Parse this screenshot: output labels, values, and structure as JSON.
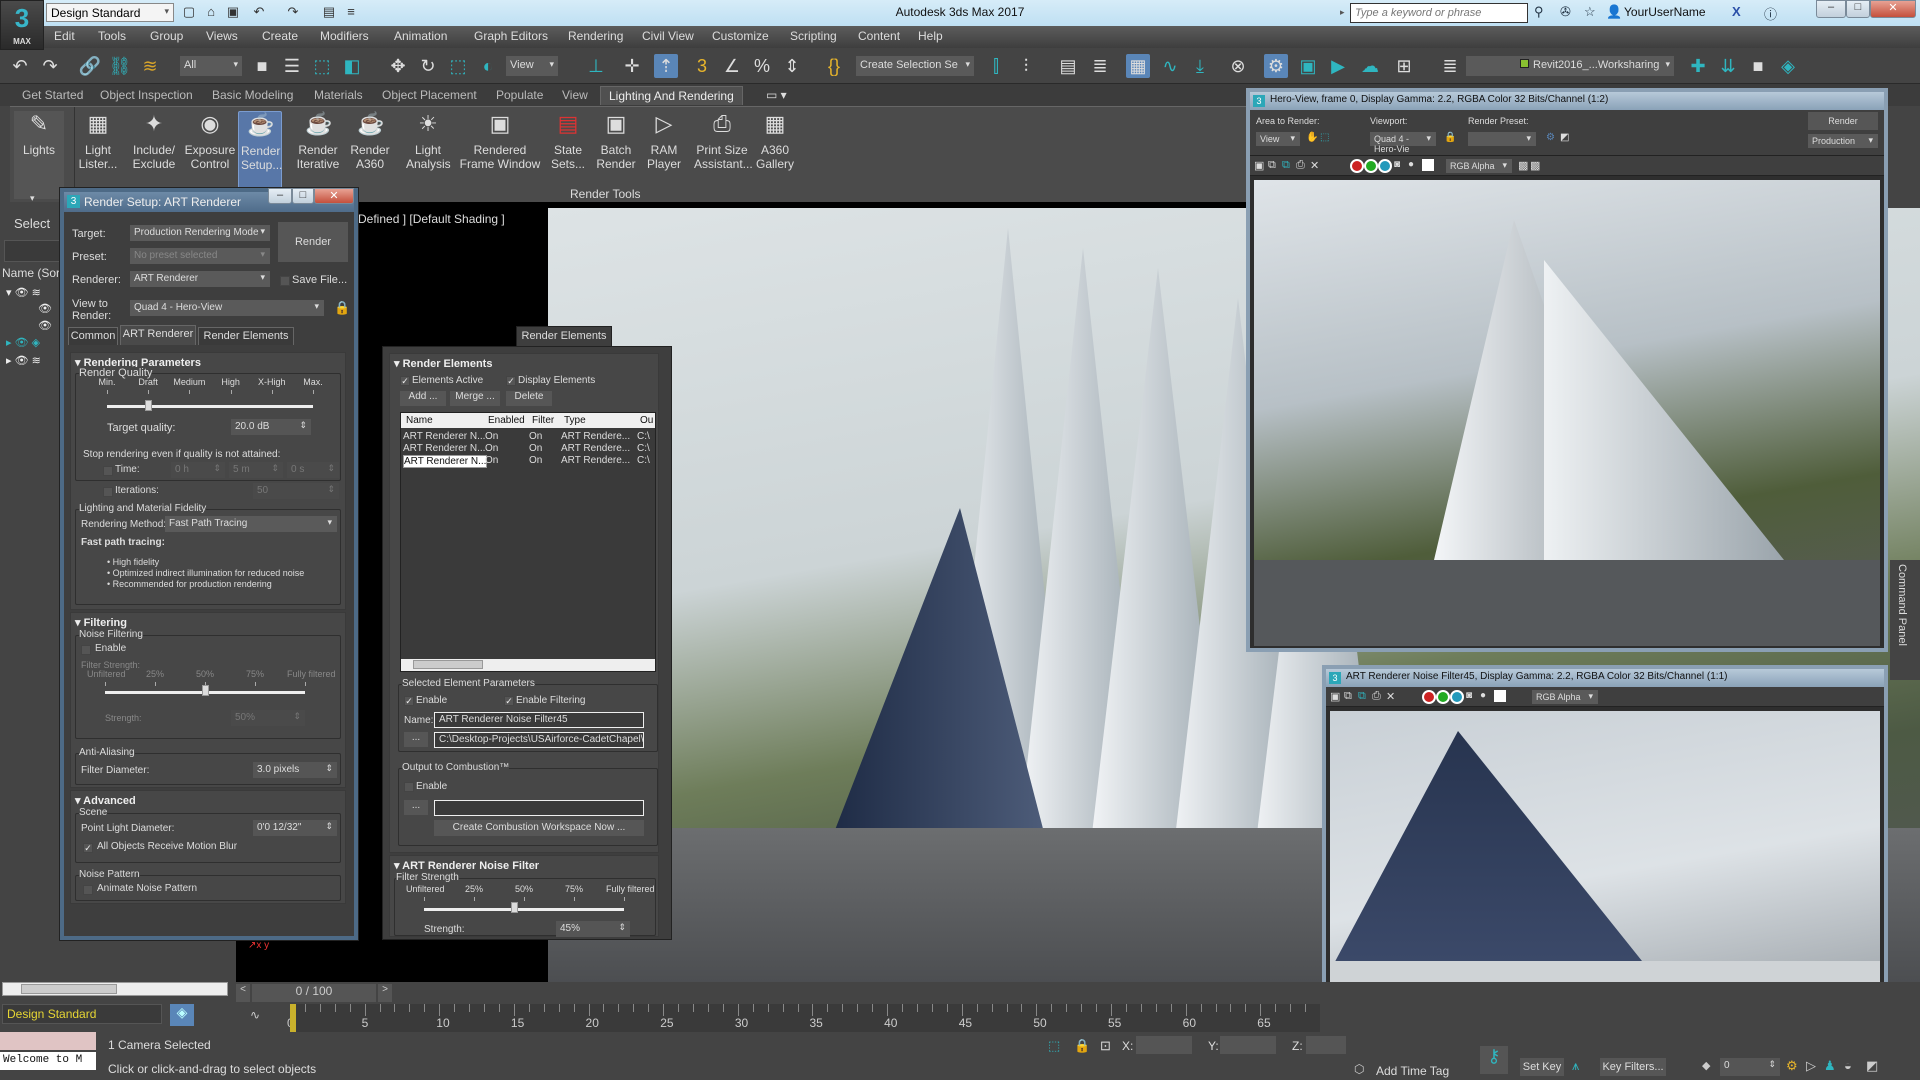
{
  "app": {
    "title": "Autodesk 3ds Max 2017",
    "logo_text": "3",
    "logo_sub": "MAX",
    "workspace": "Design Standard",
    "search_placeholder": "Type a keyword or phrase",
    "username": "YourUserName"
  },
  "menu": [
    "Edit",
    "Tools",
    "Group",
    "Views",
    "Create",
    "Modifiers",
    "Animation",
    "Graph Editors",
    "Rendering",
    "Civil View",
    "Customize",
    "Scripting",
    "Content",
    "Help"
  ],
  "toolbar": {
    "selection_filter": "All",
    "ref_coord": "View",
    "named_selection": "Create Selection Se",
    "layer_name": "Revit2016_...Worksharing"
  },
  "ribbon_tabs": [
    "Get Started",
    "Object Inspection",
    "Basic Modeling",
    "Materials",
    "Object Placement",
    "Populate",
    "View",
    "Lighting And Rendering"
  ],
  "ribbon_active_tab": "Lighting And Rendering",
  "ribbon": {
    "lights_label": "Lights",
    "buttons": [
      {
        "label1": "Light",
        "label2": "Lister...",
        "icon": "light-lister-icon"
      },
      {
        "label1": "Include/",
        "label2": "Exclude",
        "icon": "include-exclude-icon"
      },
      {
        "label1": "Exposure",
        "label2": "Control",
        "icon": "exposure-icon"
      },
      {
        "label1": "Render",
        "label2": "Setup...",
        "icon": "render-setup-icon"
      },
      {
        "label1": "Render",
        "label2": "Iterative",
        "icon": "render-iterative-icon"
      },
      {
        "label1": "Render",
        "label2": "A360",
        "icon": "render-a360-icon"
      },
      {
        "label1": "Light",
        "label2": "Analysis",
        "icon": "light-analysis-icon"
      },
      {
        "label1": "Rendered",
        "label2": "Frame Window",
        "icon": "frame-window-icon"
      },
      {
        "label1": "State",
        "label2": "Sets...",
        "icon": "state-sets-icon"
      },
      {
        "label1": "Batch",
        "label2": "Render",
        "icon": "batch-render-icon"
      },
      {
        "label1": "RAM",
        "label2": "Player",
        "icon": "ram-player-icon"
      },
      {
        "label1": "Print Size",
        "label2": "Assistant...",
        "icon": "print-size-icon"
      },
      {
        "label1": "A360",
        "label2": "Gallery",
        "icon": "a360-gallery-icon"
      }
    ],
    "group_label": "Render Tools"
  },
  "scene_explorer": {
    "select_label": "Select",
    "column_header": "Name (Sort"
  },
  "viewport": {
    "label": "Defined ] [Default Shading ]"
  },
  "render_setup": {
    "title": "Render Setup: ART Renderer",
    "target_label": "Target:",
    "target_value": "Production Rendering Mode",
    "preset_label": "Preset:",
    "preset_value": "No preset selected",
    "renderer_label": "Renderer:",
    "renderer_value": "ART Renderer",
    "save_file_label": "Save File",
    "view_label_1": "View to",
    "view_label_2": "Render:",
    "view_value": "Quad 4 - Hero-View",
    "render_button": "Render",
    "tabs": [
      "Common",
      "ART Renderer",
      "Render Elements"
    ],
    "active_tab": "ART Renderer",
    "rendering_parameters": {
      "header": "Rendering Parameters",
      "quality_group": "Render Quality",
      "quality_ticks": [
        "Min.",
        "Draft",
        "Medium",
        "High",
        "X-High",
        "Max."
      ],
      "quality_slider_fraction": 0.2,
      "target_quality_label": "Target quality:",
      "target_quality_value": "20.0 dB",
      "stop_label": "Stop rendering even if quality is not attained:",
      "time_label": "Time:",
      "time_h": "0 h",
      "time_m": "5 m",
      "time_s": "0 s",
      "iterations_label": "Iterations:",
      "iterations_value": "50",
      "fidelity_group": "Lighting and Material Fidelity",
      "method_label": "Rendering Method:",
      "method_value": "Fast Path Tracing",
      "fast_path_title": "Fast path tracing:",
      "bullets": [
        "High fidelity",
        "Optimized indirect illumination for reduced noise",
        "Recommended for production rendering"
      ]
    },
    "filtering": {
      "header": "Filtering",
      "noise_group": "Noise Filtering",
      "enable_label": "Enable",
      "strength_title": "Filter Strength:",
      "ticks": [
        "Unfiltered",
        "25%",
        "50%",
        "75%",
        "Fully filtered"
      ],
      "slider_fraction": 0.5,
      "strength_label": "Strength:",
      "strength_value": "50%",
      "aa_group": "Anti-Aliasing",
      "filter_diameter_label": "Filter Diameter:",
      "filter_diameter_value": "3.0 pixels"
    },
    "advanced": {
      "header": "Advanced",
      "scene_group": "Scene",
      "point_light_label": "Point Light Diameter:",
      "point_light_value": "0'0 12/32\"",
      "motion_blur_label": "All Objects Receive Motion Blur",
      "noise_pattern_group": "Noise Pattern",
      "animate_noise_label": "Animate Noise Pattern"
    }
  },
  "render_elements": {
    "tab_label": "Render Elements",
    "header": "Render Elements",
    "elements_active": "Elements Active",
    "display_elements": "Display Elements",
    "add": "Add ...",
    "merge": "Merge ...",
    "delete": "Delete",
    "columns": [
      "Name",
      "Enabled",
      "Filter",
      "Type",
      "Ou"
    ],
    "rows": [
      [
        "ART Renderer N...",
        "On",
        "On",
        "ART Rendere...",
        "C:\\"
      ],
      [
        "ART Renderer N...",
        "On",
        "On",
        "ART Rendere...",
        "C:\\"
      ],
      [
        "ART Renderer N...",
        "On",
        "On",
        "ART Rendere...",
        "C:\\"
      ]
    ],
    "selected_group": "Selected Element Parameters",
    "enable": "Enable",
    "enable_filtering": "Enable Filtering",
    "name_label": "Name:",
    "name_value": "ART Renderer Noise Filter45",
    "browse": "...",
    "path_value": "C:\\Desktop-Projects\\USAirforce-CadetChapel\\USA",
    "combustion_group": "Output to Combustion™",
    "combustion_enable": "Enable",
    "combustion_button": "Create Combustion Workspace Now ...",
    "noise_filter_header": "ART Renderer Noise Filter",
    "filter_strength_group": "Filter Strength",
    "ticks": [
      "Unfiltered",
      "25%",
      "50%",
      "75%",
      "Fully filtered"
    ],
    "slider_fraction": 0.45,
    "strength_label": "Strength:",
    "strength_value": "45%"
  },
  "frame_window_1": {
    "title": "Hero-View, frame 0, Display Gamma: 2.2, RGBA Color 32 Bits/Channel (1:2)",
    "area_label": "Area to Render:",
    "area_value": "View",
    "viewport_label": "Viewport:",
    "viewport_value": "Quad 4 - Hero-Vie",
    "preset_label": "Render Preset:",
    "preset_value": "",
    "render_button": "Render",
    "mode_value": "Production",
    "channel_value": "RGB Alpha"
  },
  "frame_window_2": {
    "title": "ART Renderer Noise Filter45, Display Gamma: 2.2, RGBA Color 32 Bits/Channel (1:1)",
    "channel_value": "RGB Alpha"
  },
  "command_panel_label": "Command Panel",
  "timeline": {
    "frame_counter": "0 / 100",
    "ticks": [
      "0",
      "5",
      "10",
      "15",
      "20",
      "25",
      "30",
      "35",
      "40",
      "45",
      "50",
      "55",
      "60",
      "65"
    ]
  },
  "status": {
    "workspace": "Design Standard",
    "listener": "Welcome to M",
    "selection": "1 Camera Selected",
    "prompt": "Click or click-and-drag to select objects",
    "x_label": "X:",
    "y_label": "Y:",
    "z_label": "Z:",
    "add_time_tag": "Add Time Tag",
    "set_key": "Set Key",
    "key_filters": "Key Filters...",
    "current_frame": "0"
  },
  "colors": {
    "accent_blue": "#5877a8",
    "teal": "#2fb6c0",
    "title_bar": "#bfe0f3"
  }
}
